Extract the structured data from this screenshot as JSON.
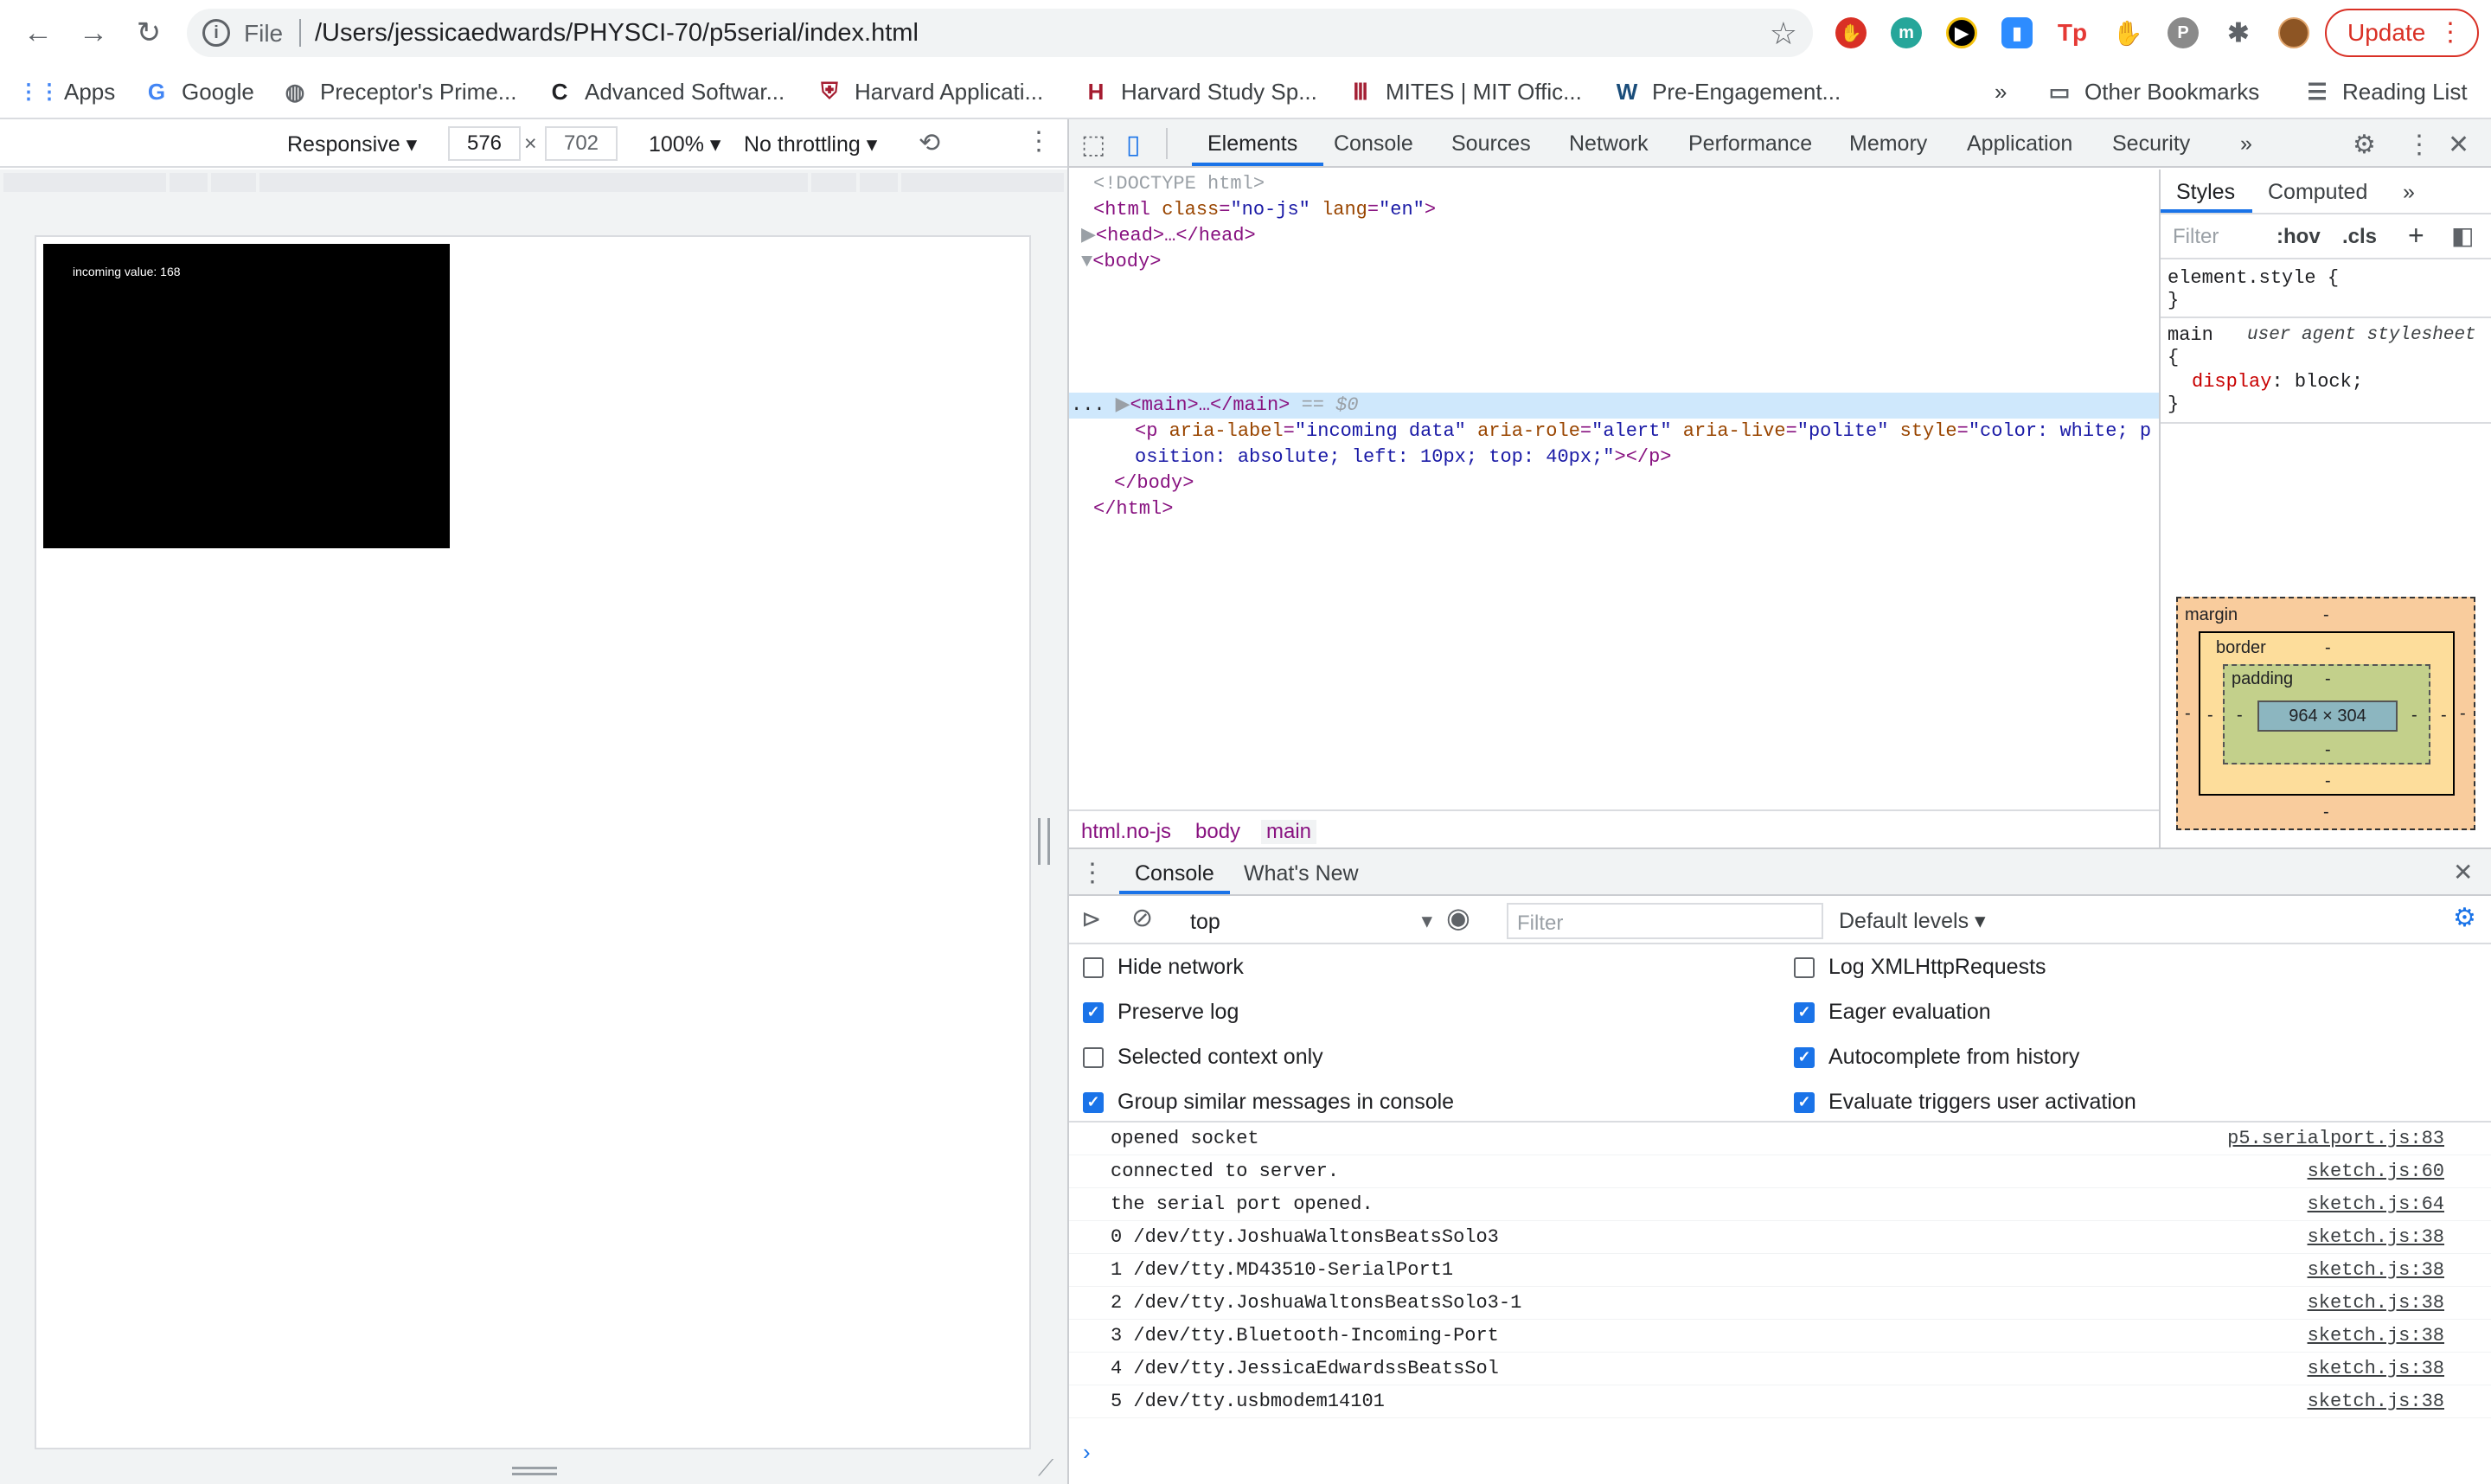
{
  "browser": {
    "url_scheme": "File",
    "url": "/Users/jessicaedwards/PHYSCI-70/p5serial/index.html",
    "update_label": "Update"
  },
  "bookmarks": [
    {
      "label": "Apps",
      "icon": "apps-grid-icon"
    },
    {
      "label": "Google",
      "icon": "google-icon"
    },
    {
      "label": "Preceptor's Prime...",
      "icon": "globe-icon"
    },
    {
      "label": "Advanced Softwar...",
      "icon": "c-logo-icon"
    },
    {
      "label": "Harvard Applicati...",
      "icon": "harvard-shield-icon"
    },
    {
      "label": "Harvard Study Sp...",
      "icon": "h-logo-icon"
    },
    {
      "label": "MITES | MIT Offic...",
      "icon": "mit-logo-icon"
    },
    {
      "label": "Pre-Engagement...",
      "icon": "w-logo-icon"
    }
  ],
  "bookmarks_more": "»",
  "other_bookmarks": "Other Bookmarks",
  "reading_list": "Reading List",
  "device": {
    "mode": "Responsive",
    "width": "576",
    "height": "702",
    "zoom": "100%",
    "throttling": "No throttling"
  },
  "canvas": {
    "text": "incoming value: 168"
  },
  "devtools": {
    "tabs": [
      "Elements",
      "Console",
      "Sources",
      "Network",
      "Performance",
      "Memory",
      "Application",
      "Security"
    ],
    "more": "»",
    "dom": {
      "doctype": "<!DOCTYPE html>",
      "html_open_tag": "<html",
      "html_class_attr": "class",
      "html_class_val": "\"no-js\"",
      "html_lang_attr": "lang",
      "html_lang_val": "\"en\"",
      "html_open_close": ">",
      "head": "<head>…</head>",
      "body_open": "<body>",
      "main": "<main>…</main>",
      "main_suffix": "== $0",
      "p_tag": "<p",
      "p_aria_label_attr": "aria-label",
      "p_aria_label_val": "\"incoming data\"",
      "p_aria_role_attr": "aria-role",
      "p_aria_role_val": "\"alert\"",
      "p_aria_live_attr": "aria-live",
      "p_aria_live_val": "\"polite\"",
      "p_style_attr": "style",
      "p_style_val_1": "\"color: white; p",
      "p_style_val_2": "osition: absolute; left: 10px; top: 40px;\"",
      "p_close": "></p>",
      "body_close": "</body>",
      "html_close": "</html>",
      "row_dots": "..."
    },
    "breadcrumbs": [
      "html.no-js",
      "body",
      "main"
    ],
    "styles_tabs": [
      "Styles",
      "Computed"
    ],
    "styles_more": "»",
    "styles_filter": "Filter",
    "hov": ":hov",
    "cls": ".cls",
    "element_style": "element.style {",
    "element_style_close": "}",
    "main_selector": "main",
    "ua_stylesheet": "user agent stylesheet",
    "open_brace": "{",
    "display_prop": "display",
    "display_val": "block;",
    "close_brace": "}",
    "box_model": {
      "margin": "margin",
      "border": "border",
      "padding": "padding",
      "content": "964 × 304",
      "dash": "-"
    },
    "drawer_tabs": [
      "Console",
      "What's New"
    ],
    "context": "top",
    "filter_placeholder": "Filter",
    "levels": "Default levels",
    "settings_left": [
      {
        "label": "Hide network",
        "checked": false
      },
      {
        "label": "Preserve log",
        "checked": true
      },
      {
        "label": "Selected context only",
        "checked": false
      },
      {
        "label": "Group similar messages in console",
        "checked": true
      }
    ],
    "settings_right": [
      {
        "label": "Log XMLHttpRequests",
        "checked": false
      },
      {
        "label": "Eager evaluation",
        "checked": true
      },
      {
        "label": "Autocomplete from history",
        "checked": true
      },
      {
        "label": "Evaluate triggers user activation",
        "checked": true
      }
    ],
    "logs": [
      {
        "msg": "opened socket",
        "src": "p5.serialport.js:83"
      },
      {
        "msg": "connected to server.",
        "src": "sketch.js:60"
      },
      {
        "msg": "the serial port opened.",
        "src": "sketch.js:64"
      },
      {
        "msg": "0 /dev/tty.JoshuaWaltonsBeatsSolo3",
        "src": "sketch.js:38"
      },
      {
        "msg": "1 /dev/tty.MD43510-SerialPort1",
        "src": "sketch.js:38"
      },
      {
        "msg": "2 /dev/tty.JoshuaWaltonsBeatsSolo3-1",
        "src": "sketch.js:38"
      },
      {
        "msg": "3 /dev/tty.Bluetooth-Incoming-Port",
        "src": "sketch.js:38"
      },
      {
        "msg": "4 /dev/tty.JessicaEdwardssBeatsSol",
        "src": "sketch.js:38"
      },
      {
        "msg": "5 /dev/tty.usbmodem14101",
        "src": "sketch.js:38"
      }
    ],
    "prompt": "›"
  }
}
